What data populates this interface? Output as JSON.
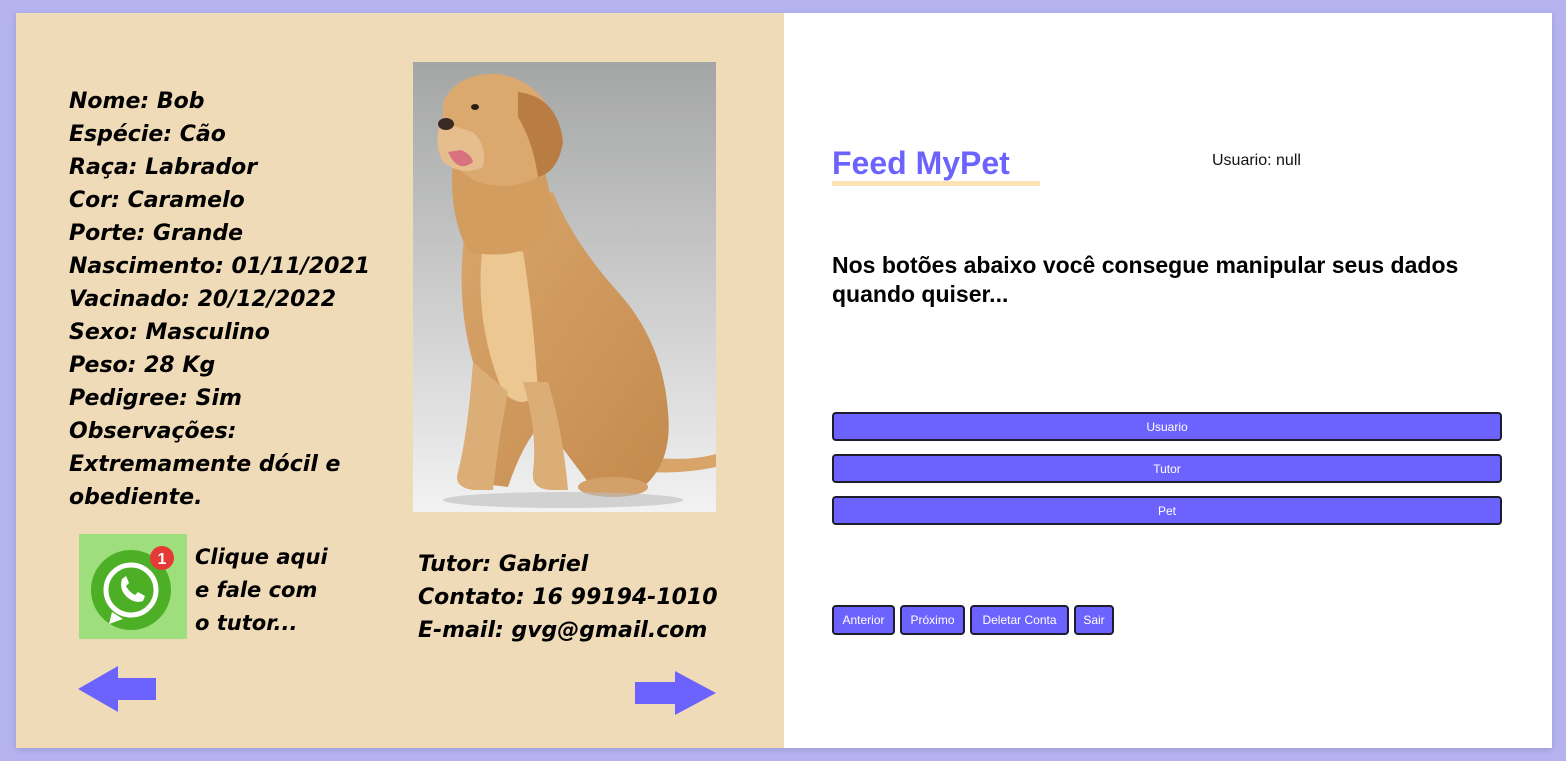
{
  "pet": {
    "lines": [
      "Nome: Bob",
      "Espécie: Cão",
      "Raça: Labrador",
      "Cor: Caramelo",
      "Porte: Grande",
      "Nascimento: 01/11/2021",
      "Vacinado: 20/12/2022",
      "Sexo: Masculino",
      "Peso: 28 Kg",
      "Pedigree: Sim"
    ],
    "observacoes": "Observações: Extremamente dócil e obediente."
  },
  "whatsapp": {
    "icon": "whatsapp-icon",
    "badge": "1",
    "text_lines": [
      "Clique aqui",
      "e fale com",
      "o tutor..."
    ]
  },
  "tutor": {
    "name": "Tutor: Gabriel",
    "contact": "Contato: 16 99194-1010",
    "email": "E-mail: gvg@gmail.com"
  },
  "nav": {
    "prev_icon": "arrow-left-icon",
    "next_icon": "arrow-right-icon"
  },
  "header": {
    "brand": "Feed MyPet",
    "user_label": "Usuario: null"
  },
  "message": "Nos botões abaixo você consegue manipular seus dados quando quiser...",
  "menu_buttons": [
    "Usuario",
    "Tutor",
    "Pet"
  ],
  "action_buttons": [
    "Anterior",
    "Próximo",
    "Deletar Conta",
    "Sair"
  ],
  "colors": {
    "background": "#b4b3f0",
    "left_panel": "#f0dbb8",
    "accent": "#6c63ff",
    "whatsapp_green": "#4caf25",
    "whatsapp_box": "#9ede7c",
    "badge_red": "#e53935"
  }
}
